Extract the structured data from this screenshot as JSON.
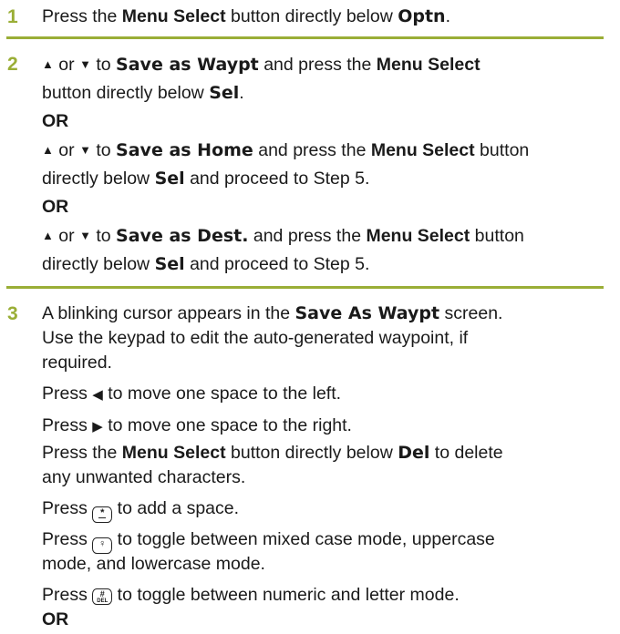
{
  "step1": {
    "number": "1",
    "t1": "Press the ",
    "b1": "Menu Select",
    "t2": " button directly below ",
    "ui1": "Optn",
    "t3": "."
  },
  "step2": {
    "number": "2",
    "l1_or": " or ",
    "l1_to": " to ",
    "l1_ui": "Save as Waypt",
    "l1_t": " and press the ",
    "l1_b": "Menu Select",
    "l2_t": "button directly below ",
    "l2_ui": "Sel",
    "l2_end": ".",
    "or1": "OR",
    "l4_or": " or ",
    "l4_to": " to ",
    "l4_ui": "Save as Home",
    "l4_t": " and press the ",
    "l4_b": "Menu Select",
    "l4_t2": " button",
    "l5_t": "directly below ",
    "l5_ui": "Sel",
    "l5_t2": " and proceed to Step 5.",
    "or2": "OR",
    "l7_or": " or ",
    "l7_to": " to ",
    "l7_ui": "Save as Dest.",
    "l7_t": " and press the ",
    "l7_b": "Menu Select",
    "l7_t2": " button",
    "l8_t": "directly below ",
    "l8_ui": "Sel",
    "l8_t2": " and proceed to Step 5."
  },
  "step3": {
    "number": "3",
    "l1_t": "A blinking cursor appears in the ",
    "l1_ui": "Save As Waypt",
    "l1_t2": " screen.",
    "l2": "Use the keypad to edit the auto-generated waypoint, if",
    "l3": "required.",
    "l4_t": "Press ",
    "l4_t2": " to move one space to the left.",
    "l5_t": "Press ",
    "l5_t2": " to move one space to the right.",
    "l6_t": "Press the ",
    "l6_b": "Menu Select",
    "l6_t2": " button directly below ",
    "l6_ui": "Del",
    "l6_t3": " to delete",
    "l7": "any unwanted characters.",
    "l8_t": "Press ",
    "l8_t2": " to add a space.",
    "l9_t": "Press ",
    "l9_t2": " to toggle between mixed case mode, uppercase",
    "l10": "mode, and lowercase mode.",
    "l11_t": "Press ",
    "l11_t2": " to toggle between numeric and letter mode.",
    "or": "OR",
    "key_star": "*",
    "key_hash": "#",
    "key_del": "DEL"
  },
  "icons": {
    "up": "▲",
    "down": "▼",
    "left": "◀",
    "right": "▶"
  },
  "colors": {
    "accent": "#9aae36"
  }
}
